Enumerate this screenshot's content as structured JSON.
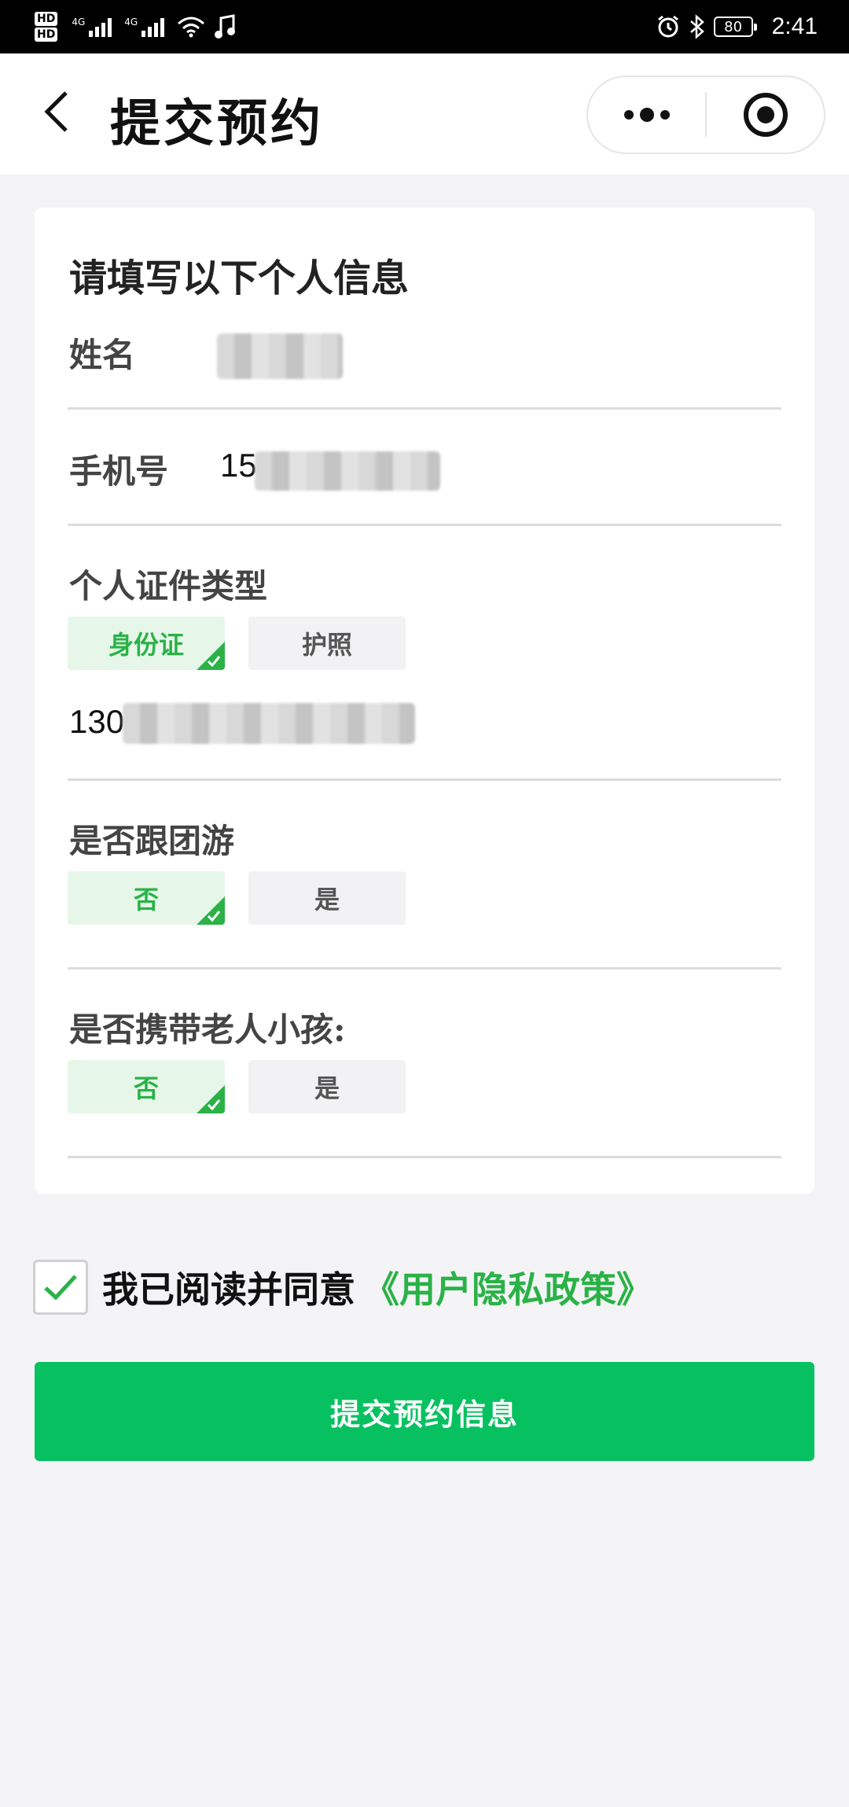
{
  "status_bar": {
    "hd_top": "HD",
    "hd_bottom": "HD",
    "net1": "4G",
    "net2": "4G",
    "battery": "80",
    "time": "2:41",
    "icons": [
      "wifi-icon",
      "music-note-icon",
      "alarm-icon",
      "bluetooth-icon",
      "battery-icon"
    ]
  },
  "nav": {
    "title": "提交预约",
    "back_icon": "chevron-left-icon",
    "more_icon": "more-dots-icon",
    "close_icon": "target-icon"
  },
  "form": {
    "heading": "请填写以下个人信息",
    "name_label": "姓名",
    "phone_label": "手机号",
    "phone_prefix": "15",
    "id_type_label": "个人证件类型",
    "id_type_options": [
      {
        "label": "身份证",
        "selected": true
      },
      {
        "label": "护照",
        "selected": false
      }
    ],
    "id_number_prefix": "130",
    "group_tour_label": "是否跟团游",
    "group_tour_options": [
      {
        "label": "否",
        "selected": true
      },
      {
        "label": "是",
        "selected": false
      }
    ],
    "elderly_child_label": "是否携带老人小孩:",
    "elderly_child_options": [
      {
        "label": "否",
        "selected": true
      },
      {
        "label": "是",
        "selected": false
      }
    ]
  },
  "agreement": {
    "checked": true,
    "text": "我已阅读并同意",
    "link": "《用户隐私政策》"
  },
  "submit_label": "提交预约信息",
  "colors": {
    "accent": "#07c160",
    "selected_bg": "#e6f7e9",
    "selected_text": "#2ab247",
    "page_bg": "#f4f4f6"
  }
}
